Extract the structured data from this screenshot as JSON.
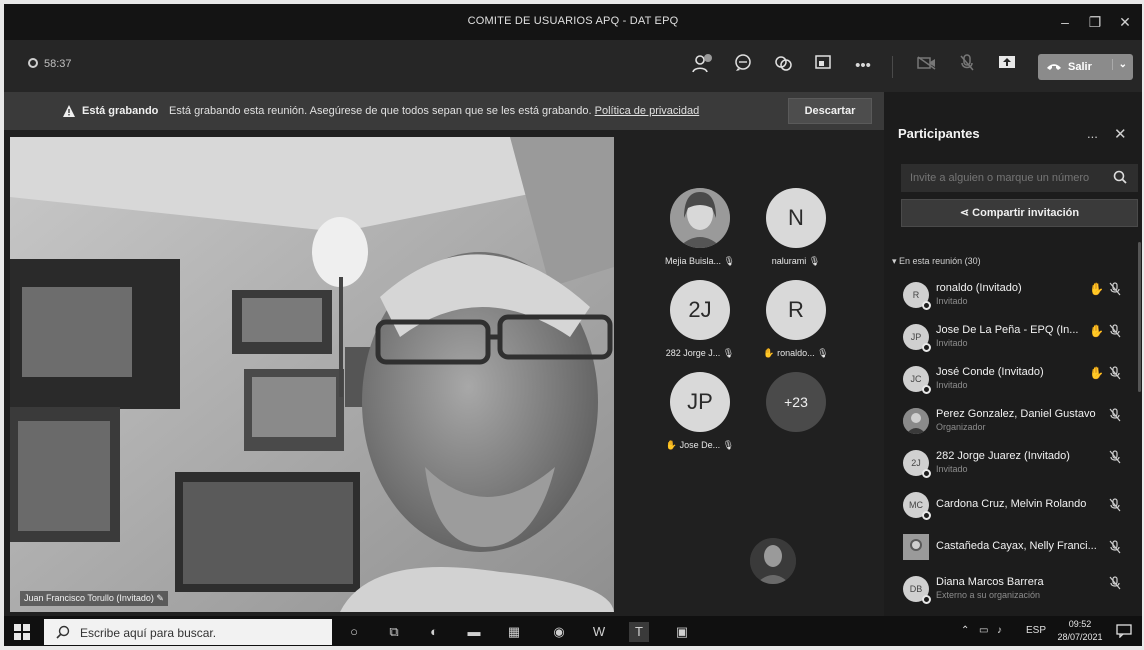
{
  "window": {
    "title": "COMITE DE USUARIOS APQ - DAT EPQ"
  },
  "toolbar": {
    "timer": "58:37",
    "participants_badge": "•",
    "leave_label": "Salir"
  },
  "banner": {
    "strong": "Está grabando",
    "message": "Está grabando esta reunión. Asegúrese de que todos sepan que se les está grabando.",
    "link": "Política de privacidad",
    "dismiss": "Descartar"
  },
  "stage": {
    "main_caption": "Juan Francisco Torullo (Invitado)",
    "tiles": [
      {
        "initials": "",
        "name": "Mejia Buisla...",
        "kind": "photo"
      },
      {
        "initials": "N",
        "name": "nalurami",
        "kind": "initials"
      },
      {
        "initials": "2J",
        "name": "282 Jorge J...",
        "kind": "initials"
      },
      {
        "initials": "R",
        "name": "ronaldo...",
        "kind": "initials"
      },
      {
        "initials": "JP",
        "name": "Jose De...",
        "kind": "initials"
      },
      {
        "initials": "+23",
        "name": "",
        "kind": "more"
      }
    ]
  },
  "panel": {
    "title": "Participantes",
    "more": "...",
    "search_placeholder": "Invite a alguien o marque un número",
    "share_label": "Compartir invitación",
    "section": "En esta reunión (30)",
    "participants": [
      {
        "initials": "R",
        "name": "ronaldo (Invitado)",
        "role": "Invitado"
      },
      {
        "initials": "JP",
        "name": "Jose De La Peña - EPQ (In...",
        "role": "Invitado"
      },
      {
        "initials": "JC",
        "name": "José Conde (Invitado)",
        "role": "Invitado"
      },
      {
        "initials": "",
        "name": "Perez Gonzalez, Daniel Gustavo",
        "role": "Organizador"
      },
      {
        "initials": "2J",
        "name": "282 Jorge Juarez (Invitado)",
        "role": "Invitado"
      },
      {
        "initials": "MC",
        "name": "Cardona Cruz, Melvin Rolando",
        "role": ""
      },
      {
        "initials": "",
        "name": "Castañeda Cayax, Nelly Franci...",
        "role": ""
      },
      {
        "initials": "DB",
        "name": "Diana Marcos Barrera",
        "role": "Externo a su organización"
      }
    ]
  },
  "taskbar": {
    "search_placeholder": "Escribe aquí para buscar.",
    "lang": "ESP",
    "time": "09:52",
    "date": "28/07/2021"
  }
}
